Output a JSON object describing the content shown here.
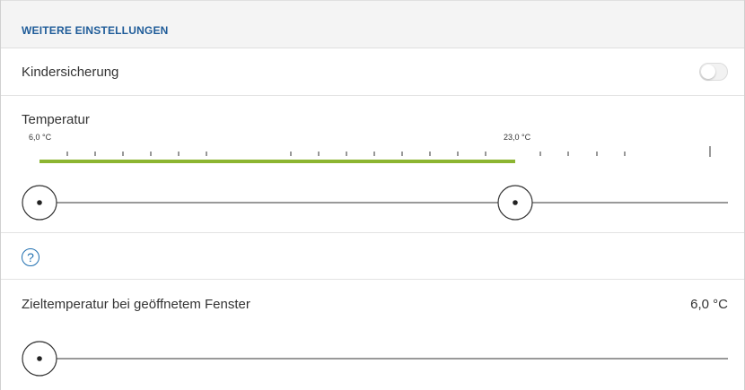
{
  "section": {
    "title": "WEITERE EINSTELLUNGEN"
  },
  "child_lock": {
    "label": "Kindersicherung",
    "enabled": false
  },
  "temperature": {
    "label": "Temperatur",
    "min_label": "6,0 °C",
    "max_label": "23,0 °C",
    "accent_color": "#8cb531",
    "range_low_fraction": 0.0,
    "range_high_fraction": 0.68
  },
  "help": {
    "icon": "help-icon",
    "glyph": "?"
  },
  "window_target": {
    "label": "Zieltemperatur bei geöffnetem Fenster",
    "value": "6,0 °C",
    "slider_fraction": 0.0
  }
}
